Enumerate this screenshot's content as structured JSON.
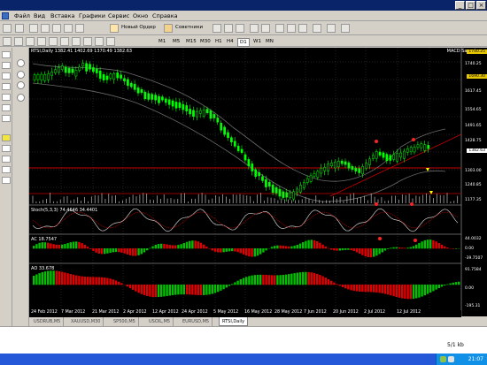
{
  "menu": {
    "items": [
      "Файл",
      "Вид",
      "Вставка",
      "Графики",
      "Сервис",
      "Окно",
      "Справка"
    ]
  },
  "toolbar": {
    "new_order": "Новый Ордер",
    "advisors": "Советники",
    "timeframes": [
      "M1",
      "M5",
      "M15",
      "M30",
      "H1",
      "H4",
      "D1",
      "W1",
      "MN"
    ]
  },
  "chart": {
    "header": "RTSI,Daily  1382.41 1402.69 1370.49 1382.63",
    "indicator_name": "MACD Sample",
    "stoch_label": "Stoch(5,3,3) 74.4646 34.4401",
    "ac_label": "AC 18.7547",
    "ao_label": "AO 33.678",
    "price_axis": [
      "1740.25",
      "1690.30",
      "1617.45",
      "1554.65",
      "1491.65",
      "1428.75",
      "1382.63",
      "1303.00",
      "1240.85",
      "1177.35"
    ],
    "ac_axis": [
      "44.0032",
      "0.00",
      "-39.7507"
    ],
    "ao_axis": [
      "91.7584",
      "0.00",
      "-195.31"
    ],
    "current_price": "1382.63",
    "colors": {
      "background": "#000000",
      "bull": "#00ff00",
      "bear": "#ff0000",
      "foreground": "#ffffff"
    }
  },
  "time_axis": [
    "24 Feb 2012",
    "7 Mar 2012",
    "21 Mar 2012",
    "2 Apr 2012",
    "12 Apr 2012",
    "24 Apr 2012",
    "5 May 2012",
    "16 May 2012",
    "28 May 2012",
    "7 Jun 2012",
    "20 Jun 2012",
    "2 Jul 2012",
    "12 Jul 2012"
  ],
  "tabs": [
    "USDRUB,M5",
    "XAUUSD,M30",
    "SP500,M5",
    "USOIL,M5",
    "EURUSD,M5",
    "RTSI,Daily"
  ],
  "status": {
    "size": "5/1 kb"
  },
  "taskbar": {
    "clock": "21:07"
  }
}
